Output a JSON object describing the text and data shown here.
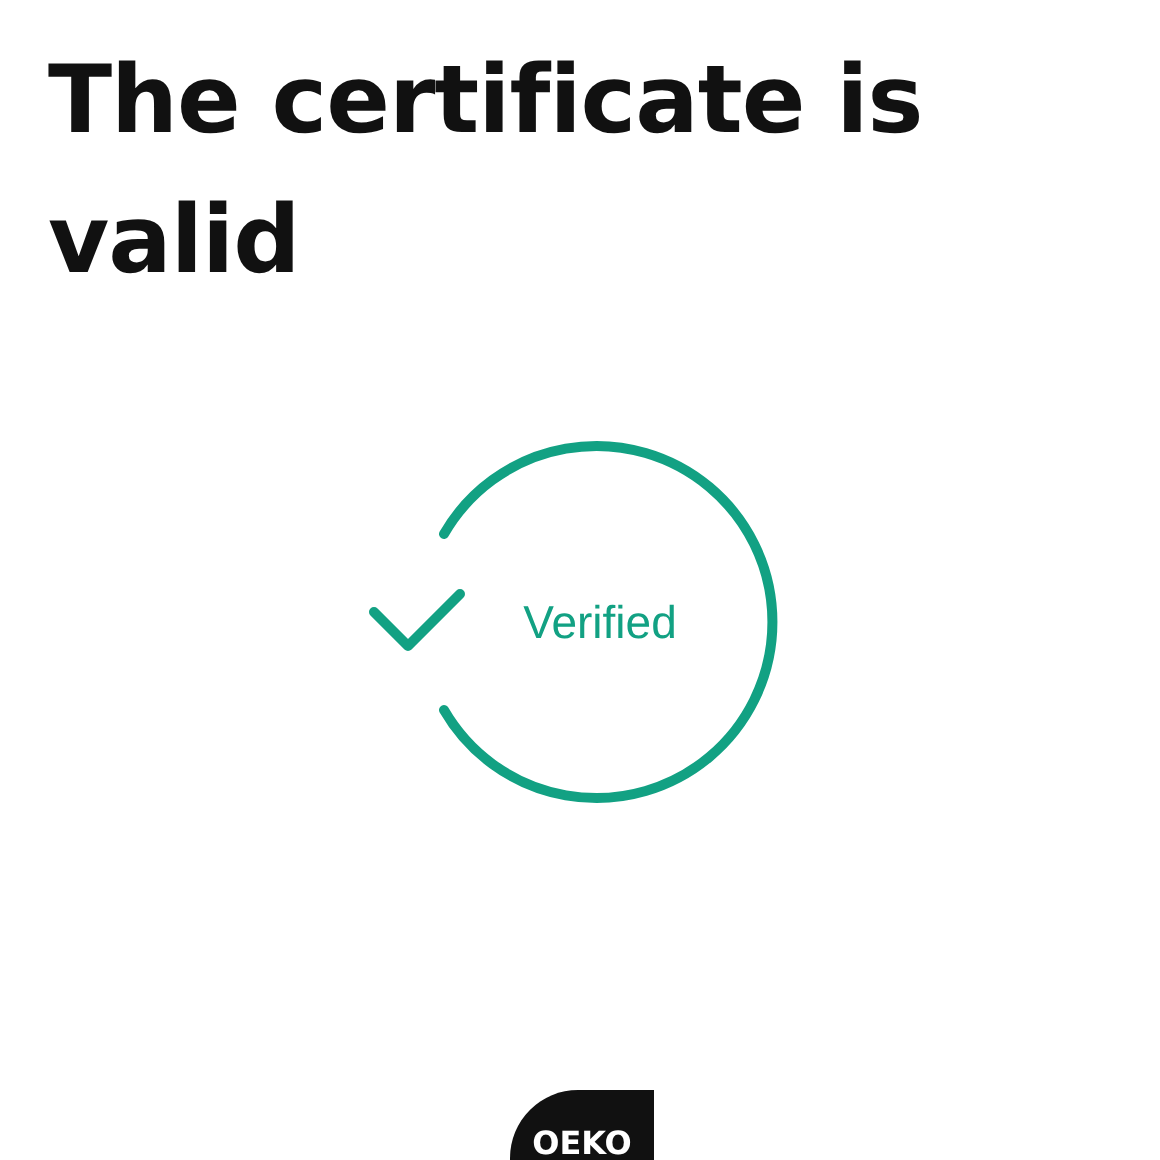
{
  "title": "The certificate is valid",
  "status": {
    "label": "Verified"
  },
  "logo": {
    "text": "OEKO"
  }
}
